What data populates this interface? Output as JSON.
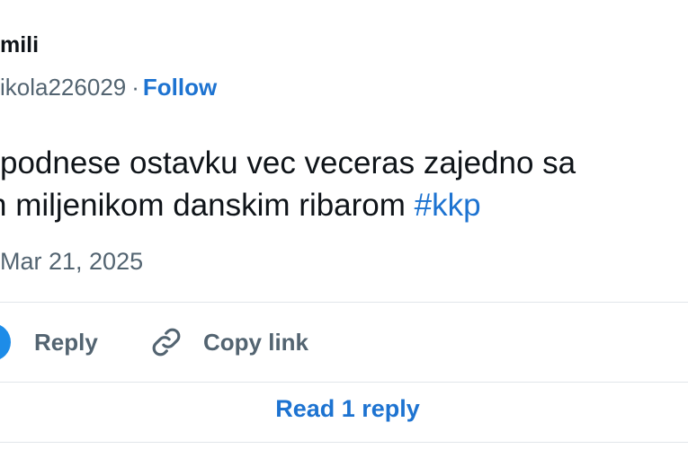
{
  "author": {
    "name": "mili",
    "handle": "ikola226029",
    "separator": "·",
    "follow_label": "Follow"
  },
  "tweet": {
    "line1": "podnese ostavku vec veceras zajedno sa",
    "line2": "miljenikom danskim ribarom",
    "line2_prefix": "n",
    "hashtag": "#kkp",
    "timestamp": "Mar 21, 2025"
  },
  "actions": {
    "reply_label": "Reply",
    "copy_link_label": "Copy link"
  },
  "footer": {
    "read_replies_label": "Read 1 reply"
  },
  "colors": {
    "link": "#1d73d1",
    "muted": "#536471",
    "reply_icon": "#1d8ce8"
  },
  "icons": {
    "reply": "reply-bubble-icon",
    "copy_link": "link-icon"
  }
}
